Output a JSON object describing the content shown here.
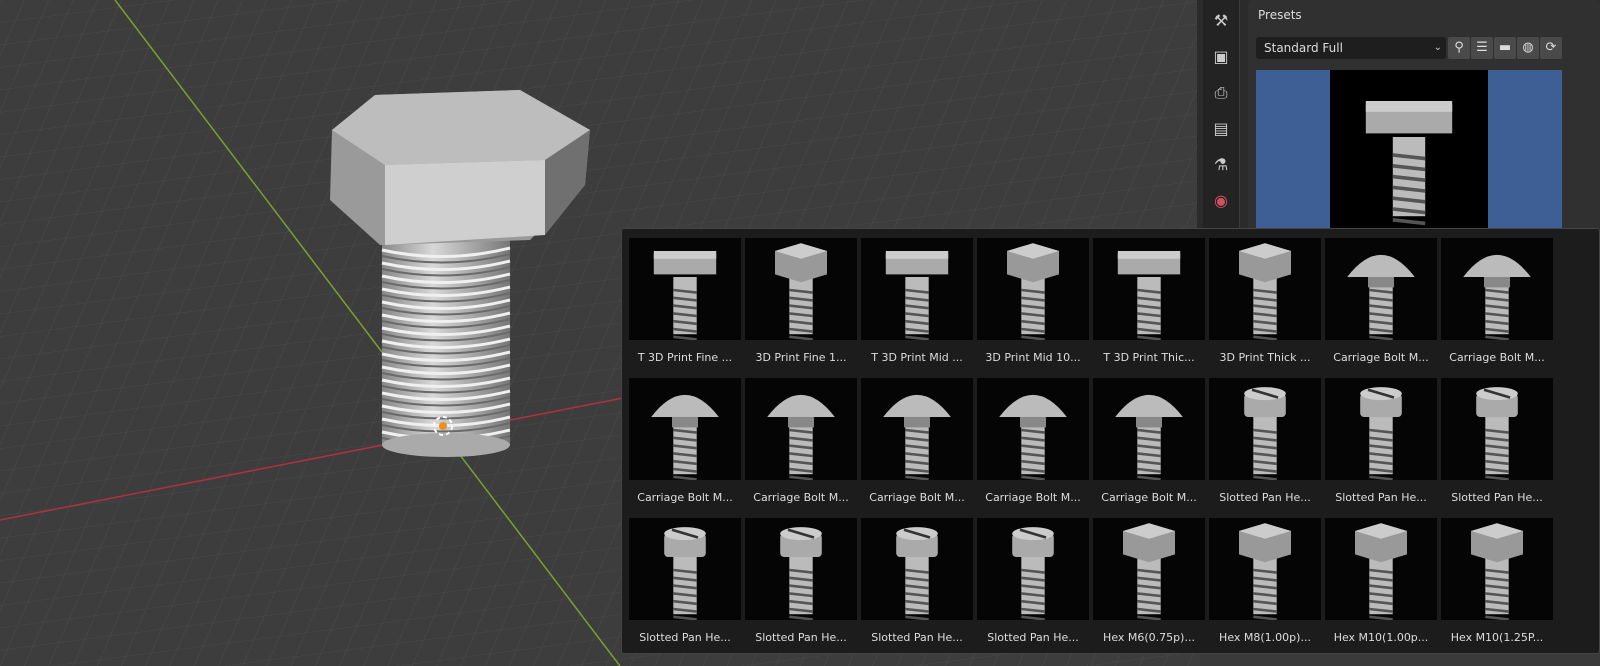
{
  "presets": {
    "title": "Presets",
    "selected": "Standard Full",
    "dropdown_icon": "chevron-down-icon",
    "toolbar": [
      {
        "icon": "search-icon",
        "glyph": "⚲"
      },
      {
        "icon": "add-list-icon",
        "glyph": "☰"
      },
      {
        "icon": "folder-icon",
        "glyph": "▬"
      },
      {
        "icon": "web-icon",
        "glyph": "◍"
      },
      {
        "icon": "refresh-icon",
        "glyph": "⟳"
      }
    ]
  },
  "properties_tabs": [
    {
      "icon": "tool-icon",
      "glyph": "⚒"
    },
    {
      "icon": "render-icon",
      "glyph": "▣"
    },
    {
      "icon": "output-icon",
      "glyph": "⎙"
    },
    {
      "icon": "view-layer-icon",
      "glyph": "▤"
    },
    {
      "icon": "scene-icon",
      "glyph": "⚗"
    },
    {
      "icon": "world-icon",
      "glyph": "◉"
    }
  ],
  "colors": {
    "world_icon": "#d05060",
    "x_axis": "#b03040",
    "y_axis": "#7aa030",
    "preview_bg": "#3d5f95"
  },
  "grid_items": [
    {
      "label": "T 3D Print Fine ...",
      "shape": "t"
    },
    {
      "label": "3D Print Fine 1...",
      "shape": "hex"
    },
    {
      "label": "T 3D Print Mid ...",
      "shape": "t"
    },
    {
      "label": "3D Print Mid 10...",
      "shape": "hex"
    },
    {
      "label": "T 3D Print Thic...",
      "shape": "t"
    },
    {
      "label": "3D Print Thick ...",
      "shape": "hex"
    },
    {
      "label": "Carriage Bolt M...",
      "shape": "carriage"
    },
    {
      "label": "Carriage Bolt M...",
      "shape": "carriage"
    },
    {
      "label": "Carriage Bolt M...",
      "shape": "carriage"
    },
    {
      "label": "Carriage Bolt M...",
      "shape": "carriage"
    },
    {
      "label": "Carriage Bolt M...",
      "shape": "carriage"
    },
    {
      "label": "Carriage Bolt M...",
      "shape": "carriage"
    },
    {
      "label": "Carriage Bolt M...",
      "shape": "carriage"
    },
    {
      "label": "Slotted Pan He...",
      "shape": "pan"
    },
    {
      "label": "Slotted Pan He...",
      "shape": "pan"
    },
    {
      "label": "Slotted Pan He...",
      "shape": "pan"
    },
    {
      "label": "Slotted Pan He...",
      "shape": "pan"
    },
    {
      "label": "Slotted Pan He...",
      "shape": "pan"
    },
    {
      "label": "Slotted Pan He...",
      "shape": "pan"
    },
    {
      "label": "Slotted Pan He...",
      "shape": "pan"
    },
    {
      "label": "Hex M6(0.75p)...",
      "shape": "hex"
    },
    {
      "label": "Hex M8(1.00p)...",
      "shape": "hex"
    },
    {
      "label": "Hex M10(1.00p...",
      "shape": "hex"
    },
    {
      "label": "Hex M10(1.25P...",
      "shape": "hex"
    }
  ]
}
